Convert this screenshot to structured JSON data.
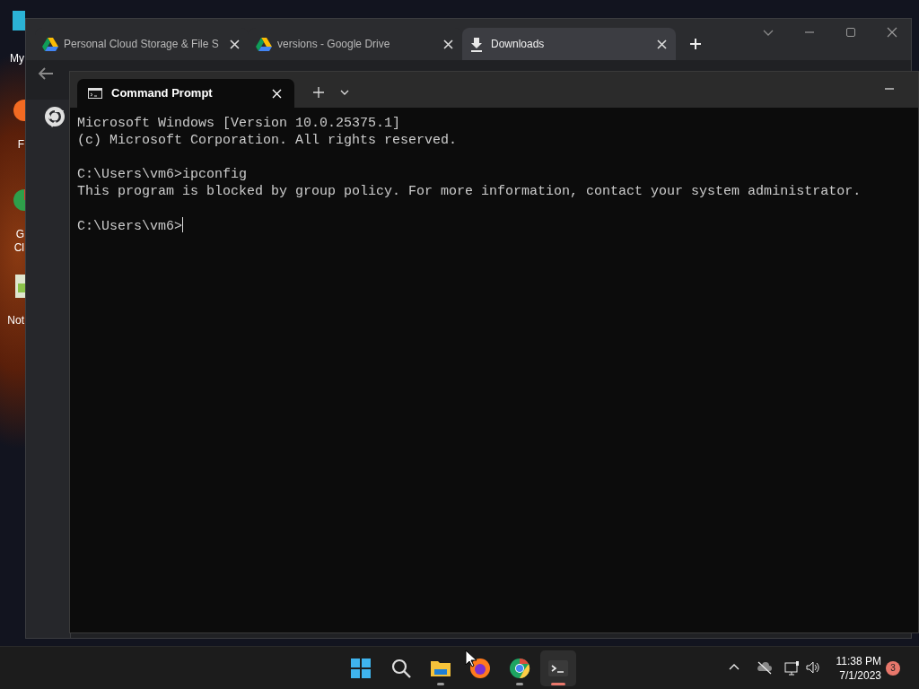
{
  "desktop_icons": [
    {
      "label": "My",
      "kind": "folder"
    },
    {
      "label": "F",
      "kind": "firefox"
    },
    {
      "label": "G\nCl",
      "kind": "chrome"
    },
    {
      "label": "Not",
      "kind": "notepad"
    }
  ],
  "browser": {
    "tabs": [
      {
        "title": "Personal Cloud Storage & File S",
        "kind": "drive",
        "selected": false
      },
      {
        "title": "versions - Google Drive",
        "kind": "drive",
        "selected": false
      },
      {
        "title": "Downloads",
        "kind": "download",
        "selected": true
      }
    ]
  },
  "terminal": {
    "tab_title": "Command Prompt",
    "blocks": [
      [
        "Microsoft Windows [Version 10.0.25375.1]",
        "(c) Microsoft Corporation. All rights reserved."
      ],
      [
        "C:\\Users\\vm6>ipconfig",
        "This program is blocked by group policy. For more information, contact your system administrator."
      ],
      [
        "C:\\Users\\vm6>"
      ]
    ]
  },
  "taskbar": {
    "apps": [
      {
        "kind": "start",
        "running": false,
        "active": false
      },
      {
        "kind": "search",
        "running": false,
        "active": false
      },
      {
        "kind": "explorer",
        "running": true,
        "active": false
      },
      {
        "kind": "firefox",
        "running": false,
        "active": false
      },
      {
        "kind": "chrome",
        "running": true,
        "active": false
      },
      {
        "kind": "terminal",
        "running": true,
        "active": true
      }
    ],
    "time": "11:38 PM",
    "date": "7/1/2023",
    "notifications": "3"
  }
}
